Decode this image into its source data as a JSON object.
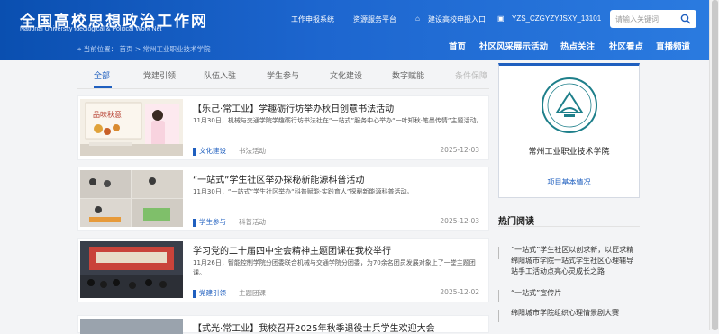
{
  "header": {
    "logo_zh": "全国高校思想政治工作网",
    "logo_en_1": "National University Ideological & Political Work Net",
    "links": [
      "工作申报系统",
      "资源服务平台",
      "建设高校申报入口"
    ],
    "user": "YZS_CZGYZYJSXY_13101",
    "search_placeholder": "请输入关键词",
    "nav": [
      "首页",
      "社区风采展示活动",
      "热点关注",
      "社区看点",
      "直播频道"
    ],
    "breadcrumb": "当前位置：  首页 > 常州工业职业技术学院"
  },
  "tabs": [
    "全部",
    "党建引领",
    "队伍入驻",
    "学生参与",
    "文化建设",
    "数字赋能",
    "条件保障"
  ],
  "articles": [
    {
      "title": "【乐己·常工业】学趣砺行坊举办秋日创意书法活动",
      "desc": "11月30日，机械与交通学院学趣砺行坊书法社在“一站式”服务中心举办“一叶知秋·笔墨传情”主题活动。",
      "tag": "文化建设",
      "tag2": "书法活动",
      "date": "2025-12-03",
      "thumb_text": "品味秋意"
    },
    {
      "title": "“一站式”学生社区举办探秘新能源科普活动",
      "desc": "11月30日，“一站式”学生社区举办“科普赋能·实践育人”探秘新能源科普活动。",
      "tag": "学生参与",
      "tag2": "科普活动",
      "date": "2025-12-03"
    },
    {
      "title": "学习党的二十届四中全会精神主题团课在我校举行",
      "desc": "11月26日，智能控制学院分团委联合机械与交通学院分团委，为70余名团员发展对象上了一堂主题团课。",
      "tag": "党建引领",
      "tag2": "主题团课",
      "date": "2025-12-02"
    },
    {
      "title": "【式光·常工业】我校召开2025年秋季退役士兵学生欢迎大会"
    }
  ],
  "school": {
    "name": "常州工业职业技术学院",
    "link": "项目基本情况"
  },
  "hot": {
    "title": "热门阅读",
    "items": [
      "“一站式”学生社区以创求新，以匠求精 绵阳城市学院一站式学生社区心理辅导站手工活动点亮心灵成长之路",
      "“一站式”宣传片",
      "绵阳城市学院组织心理情景剧大赛"
    ]
  },
  "colors": {
    "brand": "#1f5fbf",
    "header_bg": "#0a4fb0"
  }
}
